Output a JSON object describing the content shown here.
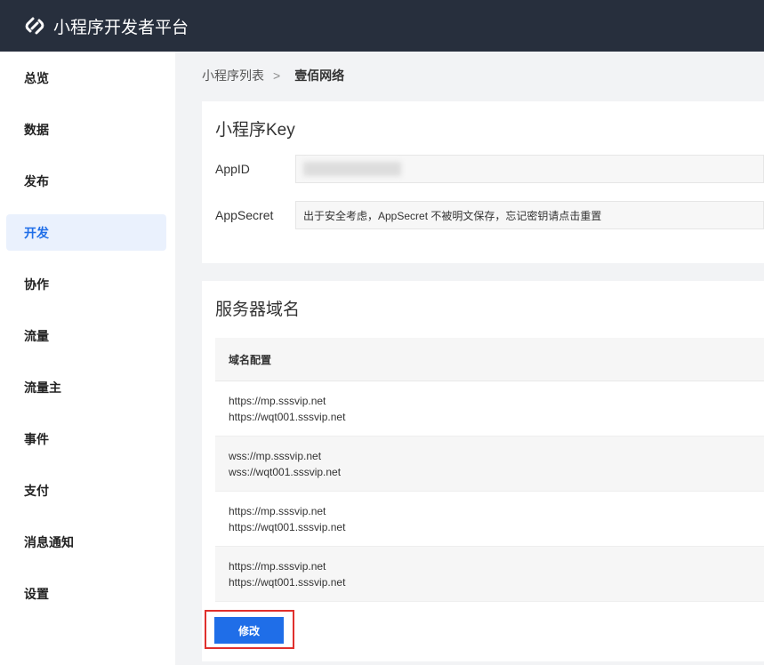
{
  "header": {
    "title": "小程序开发者平台"
  },
  "sidebar": {
    "items": [
      {
        "label": "总览"
      },
      {
        "label": "数据"
      },
      {
        "label": "发布"
      },
      {
        "label": "开发",
        "active": true
      },
      {
        "label": "协作"
      },
      {
        "label": "流量"
      },
      {
        "label": "流量主"
      },
      {
        "label": "事件"
      },
      {
        "label": "支付"
      },
      {
        "label": "消息通知"
      },
      {
        "label": "设置"
      }
    ]
  },
  "breadcrumb": {
    "parent": "小程序列表",
    "sep": ">",
    "current": "壹佰网络"
  },
  "key_section": {
    "title": "小程序Key",
    "appid_label": "AppID",
    "appsecret_label": "AppSecret",
    "appsecret_value": "出于安全考虑，AppSecret 不被明文保存，忘记密钥请点击重置"
  },
  "domain_section": {
    "title": "服务器域名",
    "column": "域名配置",
    "rows": [
      [
        "https://mp.sssvip.net",
        "https://wqt001.sssvip.net"
      ],
      [
        "wss://mp.sssvip.net",
        "wss://wqt001.sssvip.net"
      ],
      [
        "https://mp.sssvip.net",
        "https://wqt001.sssvip.net"
      ],
      [
        "https://mp.sssvip.net",
        "https://wqt001.sssvip.net"
      ]
    ],
    "edit_button": "修改"
  }
}
